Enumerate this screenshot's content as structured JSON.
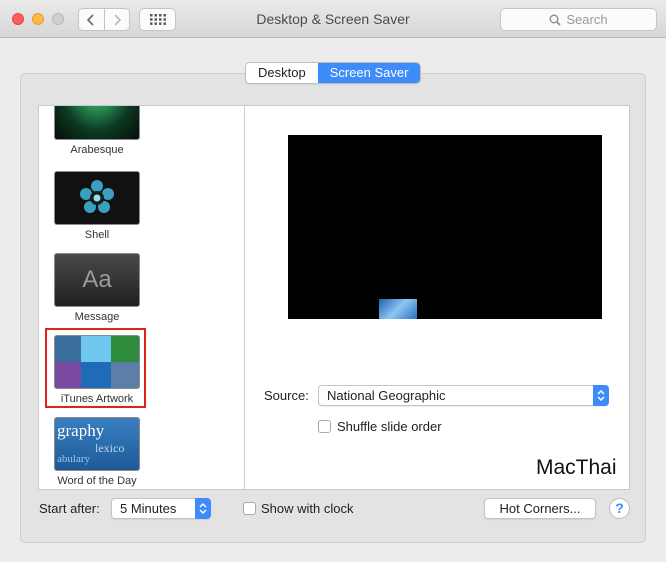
{
  "window": {
    "title": "Desktop & Screen Saver",
    "search_placeholder": "Search"
  },
  "tabs": [
    {
      "label": "Desktop",
      "active": false
    },
    {
      "label": "Screen Saver",
      "active": true
    }
  ],
  "savers": [
    {
      "label": "Arabesque"
    },
    {
      "label": "Shell"
    },
    {
      "label": "Message",
      "thumb_text": "Aa"
    },
    {
      "label": "iTunes Artwork",
      "selected": true
    },
    {
      "label": "Word of the Day",
      "thumb_words": [
        "graphy",
        "lexico",
        "abulary"
      ]
    }
  ],
  "options": {
    "source_label": "Source:",
    "source_value": "National Geographic",
    "shuffle_label": "Shuffle slide order",
    "shuffle_checked": false
  },
  "watermark": "MacThai",
  "footer": {
    "start_after_label": "Start after:",
    "start_after_value": "5 Minutes",
    "show_clock_label": "Show with clock",
    "show_clock_checked": false,
    "hot_corners_label": "Hot Corners...",
    "help_label": "?"
  },
  "colors": {
    "accent": "#3e8bfa",
    "selection_frame": "#e2231a"
  }
}
